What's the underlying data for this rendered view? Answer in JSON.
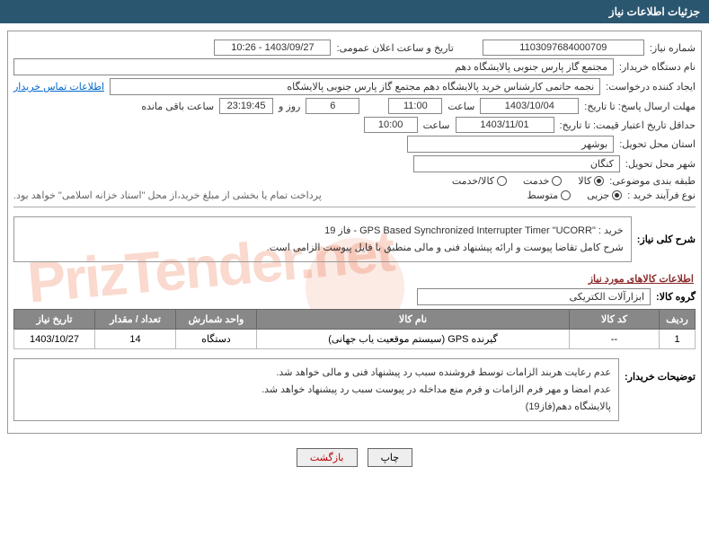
{
  "header": "جزئیات اطلاعات نیاز",
  "f": {
    "need_no_lbl": "شماره نیاز:",
    "need_no": "1103097684000709",
    "ann_date_lbl": "تاریخ و ساعت اعلان عمومی:",
    "ann_date": "1403/09/27 - 10:26",
    "buyer_lbl": "نام دستگاه خریدار:",
    "buyer": "مجتمع گاز پارس جنوبی  پالایشگاه دهم",
    "requester_lbl": "ایجاد کننده درخواست:",
    "requester": "نجمه حاتمی کارشناس خرید پالایشگاه دهم  مجتمع گاز پارس جنوبی  پالایشگاه",
    "contact_link": "اطلاعات تماس خریدار",
    "deadline_lbl": "مهلت ارسال پاسخ: تا تاریخ:",
    "deadline_date": "1403/10/04",
    "time_lbl": "ساعت",
    "deadline_time": "11:00",
    "days": "6",
    "days_lbl": "روز و",
    "countdown": "23:19:45",
    "remain_lbl": "ساعت باقی مانده",
    "validity_lbl": "حداقل تاریخ اعتبار قیمت: تا تاریخ:",
    "validity_date": "1403/11/01",
    "validity_time": "10:00",
    "province_lbl": "استان محل تحویل:",
    "province": "بوشهر",
    "city_lbl": "شهر محل تحویل:",
    "city": "کنگان",
    "cat_lbl": "طبقه بندی موضوعی:",
    "r1": "کالا",
    "r2": "خدمت",
    "r3": "کالا/خدمت",
    "proc_lbl": "نوع فرآیند خرید :",
    "p1": "جزیی",
    "p2": "متوسط",
    "pay_note": "پرداخت تمام یا بخشی از مبلغ خرید،از محل \"اسناد خزانه اسلامی\" خواهد بود.",
    "desc_title": "شرح کلی نیاز:",
    "desc_l1": "خرید : \"GPS Based Synchronized Interrupter Timer \"UCORR - فاز 19",
    "desc_l2": "شرح کامل تقاضا پیوست و ارائه پیشنهاد فنی و مالی منطبق با فایل پیوست الزامی است.",
    "items_title": "اطلاعات کالاهای مورد نیاز",
    "group_lbl": "گروه کالا:",
    "group": "ابزارآلات الکتریکی"
  },
  "tbl": {
    "h": [
      "ردیف",
      "کد کالا",
      "نام کالا",
      "واحد شمارش",
      "تعداد / مقدار",
      "تاریخ نیاز"
    ],
    "r": [
      "1",
      "--",
      "گیرنده GPS (سیستم موقعیت یاب جهانی)",
      "دستگاه",
      "14",
      "1403/10/27"
    ]
  },
  "notes": {
    "lbl": "توضیحات خریدار:",
    "l1": "عدم رعایت هربند الزامات توسط فروشنده سبب رد پیشنهاد فنی و مالی خواهد شد.",
    "l2": "عدم امضا و مهر فرم الزامات و فرم منع مداخله در پیوست سبب رد پیشنهاد خواهد شد.",
    "l3": "پالایشگاه دهم(فاز19)"
  },
  "btn": {
    "print": "چاپ",
    "back": "بازگشت"
  },
  "wm": "PrizTender.net"
}
